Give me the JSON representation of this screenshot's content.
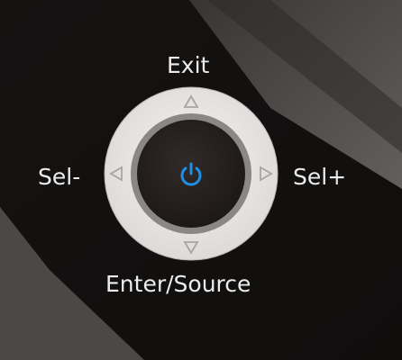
{
  "controls": {
    "top_label": "Exit",
    "left_label": "Sel-",
    "right_label": "Sel+",
    "bottom_label": "Enter/Source",
    "center_icon": "power-icon",
    "up_icon": "triangle-up-icon",
    "down_icon": "triangle-down-icon",
    "left_icon": "triangle-left-icon",
    "right_icon": "triangle-right-icon"
  },
  "colors": {
    "background_dark": "#1b1918",
    "background_light_band": "#5a5756",
    "ring": "#ecebea",
    "center_button": "#2a2523",
    "power_icon": "#1f8fe5",
    "label_text": "#ececec"
  }
}
